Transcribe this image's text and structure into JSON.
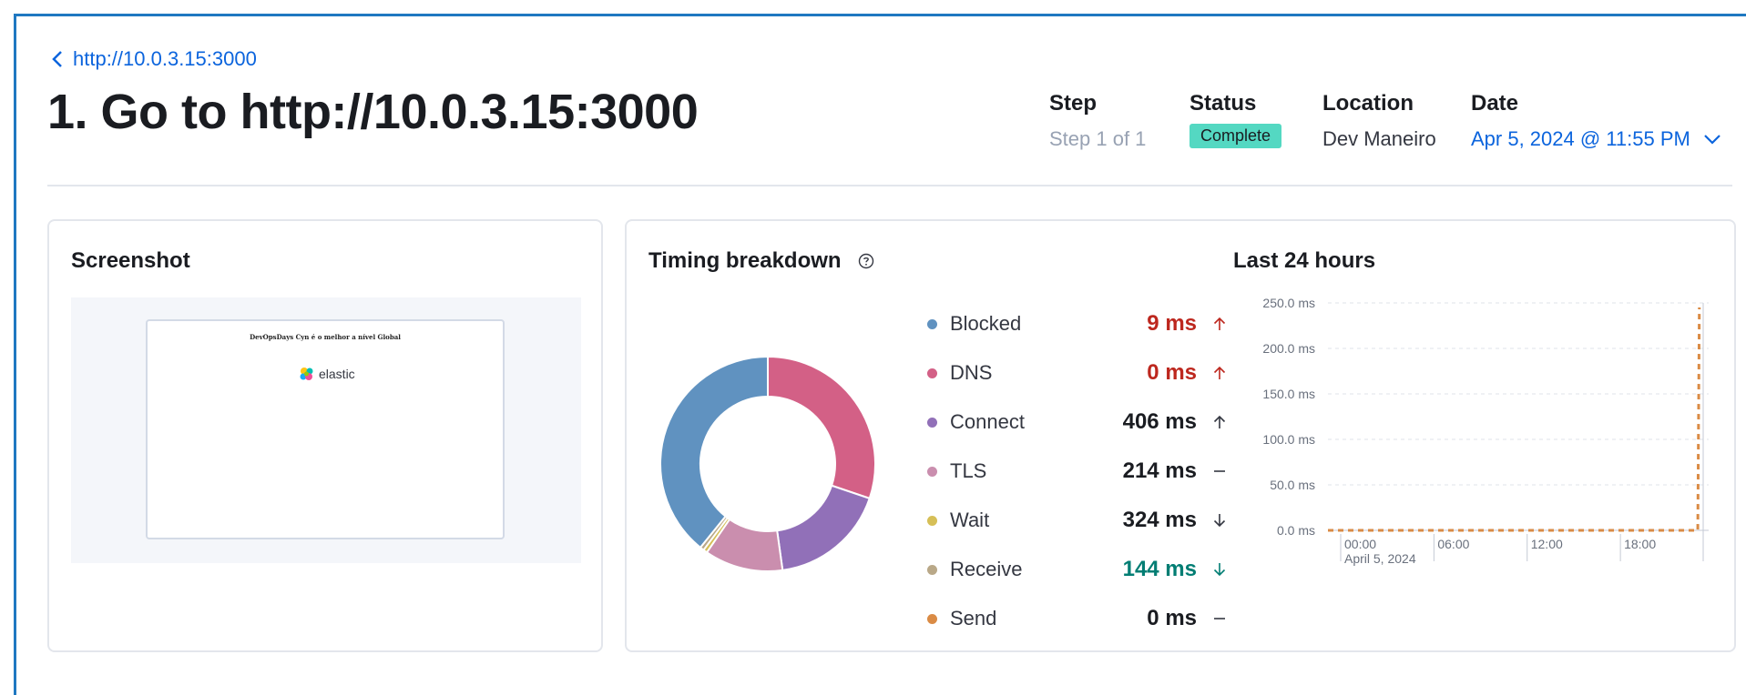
{
  "breadcrumb": {
    "back_label": "http://10.0.3.15:3000",
    "icon": "chevron-left-icon"
  },
  "page": {
    "title": "1. Go to http://10.0.3.15:3000"
  },
  "meta": {
    "step": {
      "label": "Step",
      "value": "Step 1 of 1"
    },
    "status": {
      "label": "Status",
      "value": "Complete",
      "color": "#54d8c2"
    },
    "location": {
      "label": "Location",
      "value": "Dev Maneiro"
    },
    "date": {
      "label": "Date",
      "value": "Apr 5, 2024 @ 11:55 PM",
      "icon": "chevron-down-icon"
    }
  },
  "screenshot_panel": {
    "title": "Screenshot",
    "preview_heading": "DevOpsDays Cyn é o melhor a nível Global",
    "preview_logo": "elastic"
  },
  "timing_panel": {
    "title": "Timing breakdown",
    "help_icon": "question-circle-icon",
    "items": [
      {
        "name": "Blocked",
        "value": "9 ms",
        "color": "#6092c0",
        "trend": "up",
        "status": "bad"
      },
      {
        "name": "DNS",
        "value": "0 ms",
        "color": "#d36086",
        "trend": "up",
        "status": "bad"
      },
      {
        "name": "Connect",
        "value": "406 ms",
        "color": "#9170b8",
        "trend": "up",
        "status": "neutral"
      },
      {
        "name": "TLS",
        "value": "214 ms",
        "color": "#ca8eae",
        "trend": "flat",
        "status": "neutral"
      },
      {
        "name": "Wait",
        "value": "324 ms",
        "color": "#d6bf57",
        "trend": "down",
        "status": "neutral"
      },
      {
        "name": "Receive",
        "value": "144 ms",
        "color": "#b9a888",
        "trend": "down",
        "status": "good"
      },
      {
        "name": "Send",
        "value": "0 ms",
        "color": "#da8b45",
        "trend": "flat",
        "status": "neutral"
      }
    ],
    "donut_segments": [
      {
        "name": "DNS-segment",
        "fraction": 0.302,
        "color": "#d36086"
      },
      {
        "name": "Connect-segment",
        "fraction": 0.176,
        "color": "#9170b8"
      },
      {
        "name": "TLS-segment",
        "fraction": 0.118,
        "color": "#ca8eae"
      },
      {
        "name": "Wait-segment",
        "fraction": 0.006,
        "color": "#d6bf57"
      },
      {
        "name": "Receive-segment",
        "fraction": 0.006,
        "color": "#b9a888"
      },
      {
        "name": "Blocked-segment",
        "fraction": 0.392,
        "color": "#6092c0"
      }
    ]
  },
  "history": {
    "title": "Last 24 hours",
    "chart_data": {
      "type": "line",
      "y_ticks": [
        "250.0 ms",
        "200.0 ms",
        "150.0 ms",
        "100.0 ms",
        "50.0 ms",
        "0.0 ms"
      ],
      "y_tick_values": [
        250,
        200,
        150,
        100,
        50,
        0
      ],
      "x_ticks": [
        "00:00",
        "06:00",
        "12:00",
        "18:00"
      ],
      "x_sublabel": "April 5, 2024",
      "ylim": [
        0,
        250
      ],
      "grid": true,
      "series": [
        {
          "color": "#da8b45",
          "style": "dashed",
          "points": [
            [
              0,
              0
            ],
            [
              23.8,
              0
            ],
            [
              23.9,
              245
            ]
          ]
        }
      ],
      "xlim": [
        0,
        24.5
      ]
    }
  }
}
